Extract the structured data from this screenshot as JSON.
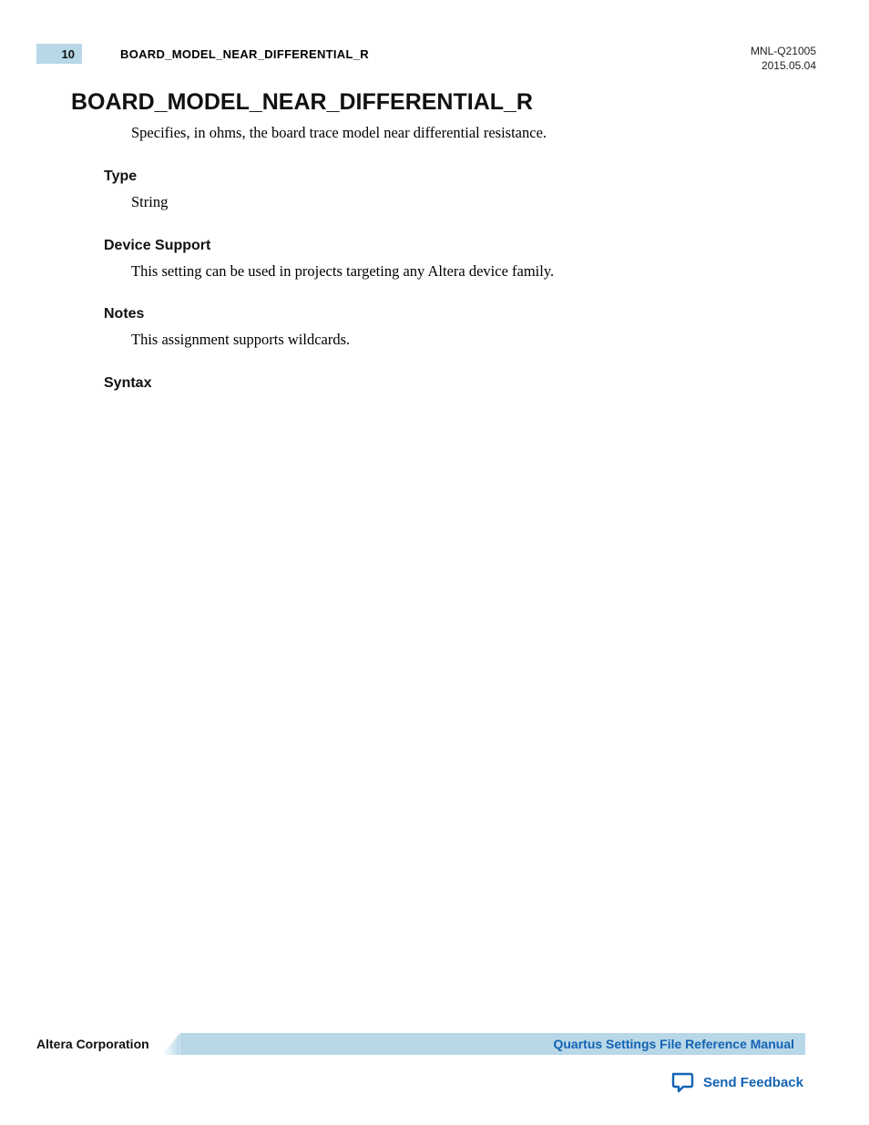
{
  "header": {
    "page_number": "10",
    "section_title": "BOARD_MODEL_NEAR_DIFFERENTIAL_R",
    "doc_id": "MNL-Q21005",
    "date": "2015.05.04"
  },
  "content": {
    "title": "BOARD_MODEL_NEAR_DIFFERENTIAL_R",
    "description": "Specifies, in ohms, the board trace model near differential resistance.",
    "type_label": "Type",
    "type_value": "String",
    "device_support_label": "Device Support",
    "device_support_value": "This setting can be used in projects targeting any Altera device family.",
    "notes_label": "Notes",
    "notes_value": "This assignment supports wildcards.",
    "syntax_label": "Syntax"
  },
  "footer": {
    "company": "Altera Corporation",
    "manual_link": "Quartus Settings File Reference Manual",
    "feedback_link": "Send Feedback"
  }
}
